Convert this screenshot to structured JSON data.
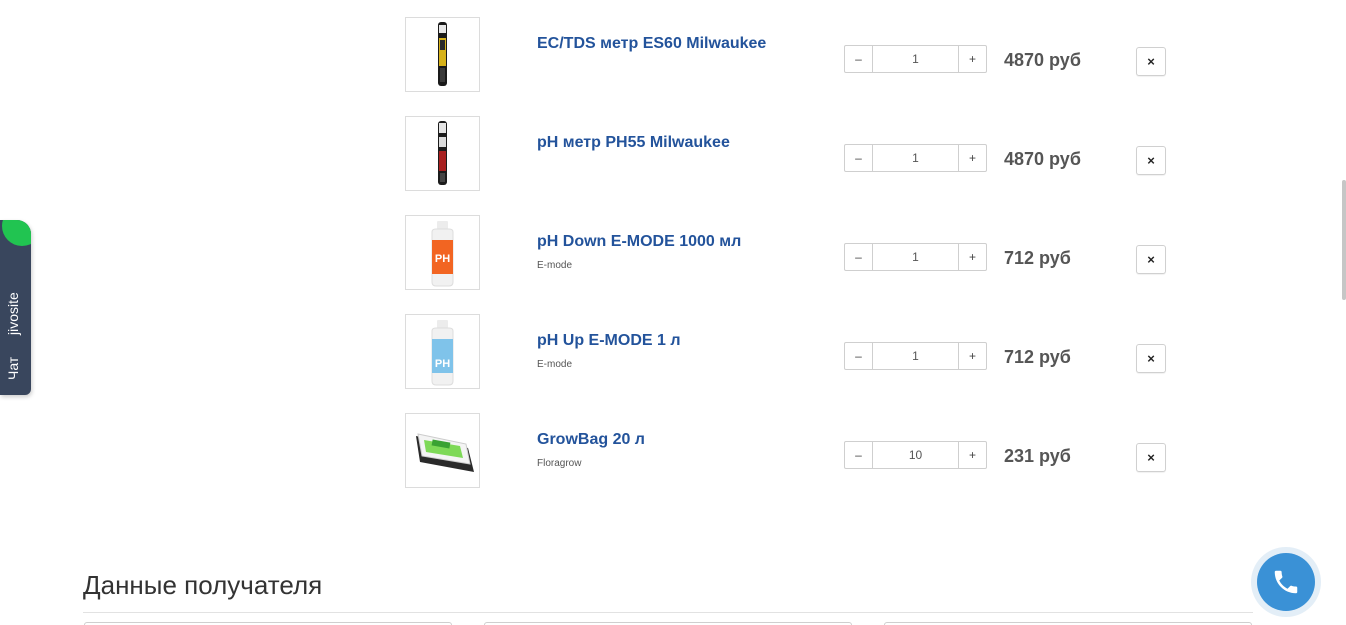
{
  "cart": {
    "items": [
      {
        "name": "EC/TDS метр ES60 Milwaukee",
        "brand": "",
        "qty": "1",
        "price": "4870 руб",
        "thumb_icon": "ec-tds-meter-icon"
      },
      {
        "name": "pH метр PH55 Milwaukee",
        "brand": "",
        "qty": "1",
        "price": "4870 руб",
        "thumb_icon": "ph-meter-icon"
      },
      {
        "name": "pH Down E-MODE 1000 мл",
        "brand": "E-mode",
        "qty": "1",
        "price": "712 руб",
        "thumb_icon": "ph-down-bottle-icon"
      },
      {
        "name": "pH Up E-MODE 1 л",
        "brand": "E-mode",
        "qty": "1",
        "price": "712 руб",
        "thumb_icon": "ph-up-bottle-icon"
      },
      {
        "name": "GrowBag 20 л",
        "brand": "Floragrow",
        "qty": "10",
        "price": "231 руб",
        "thumb_icon": "growbag-icon"
      }
    ],
    "minus_label": "–",
    "plus_label": "+",
    "remove_label": "×"
  },
  "recipient": {
    "title": "Данные получателя"
  },
  "chat_widget": {
    "label": "Чат",
    "brand": "jivosite",
    "accent": "#21c451",
    "background": "#39465d"
  },
  "call_button": {
    "icon": "phone-icon",
    "color": "#3a91d6"
  },
  "colors": {
    "product_link": "#23539b",
    "price": "#555555"
  }
}
